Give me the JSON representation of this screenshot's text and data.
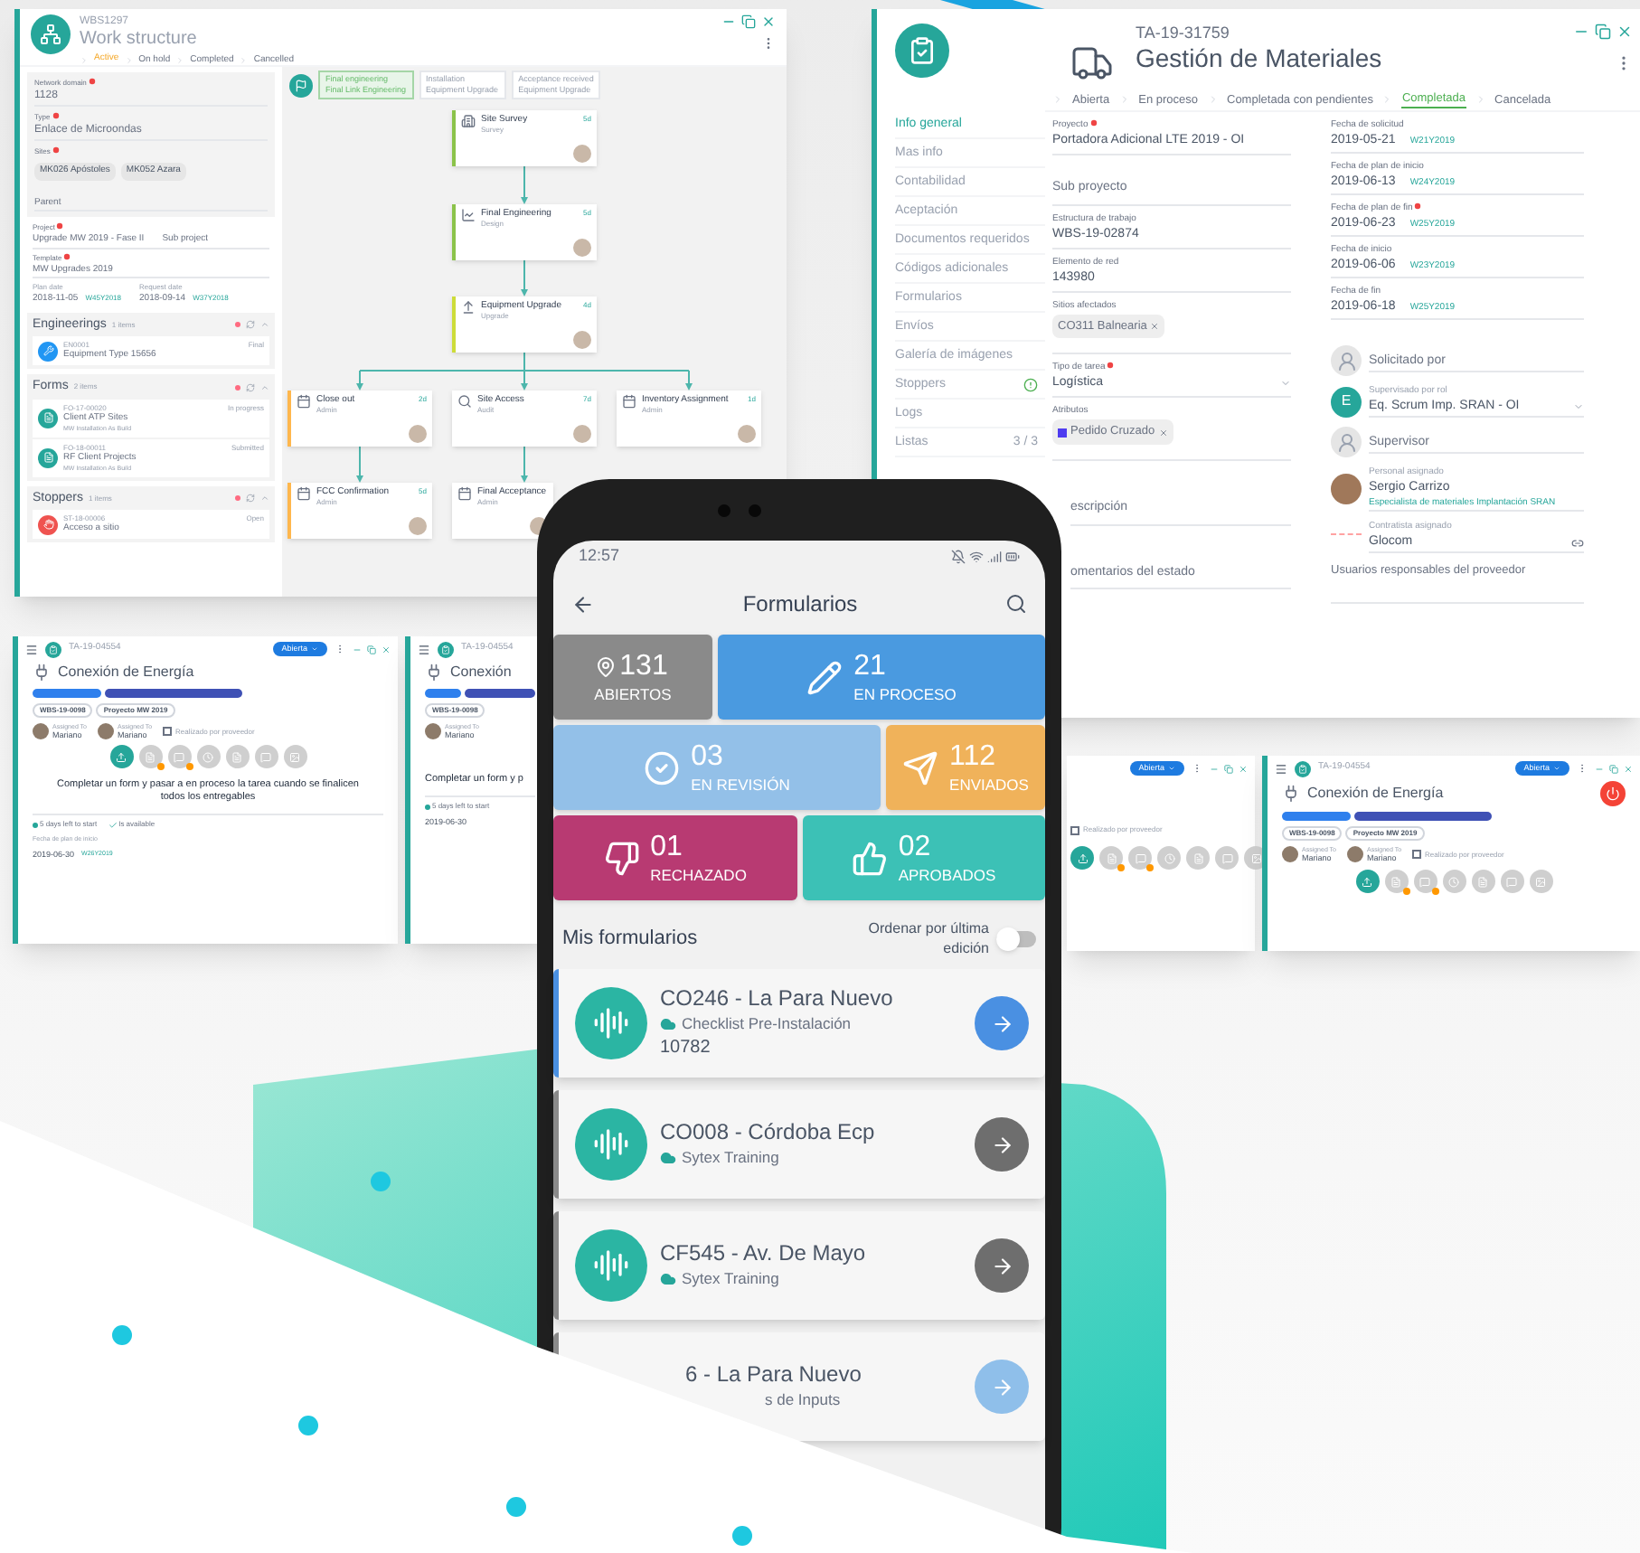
{
  "work_structure": {
    "code": "WBS1297",
    "title": "Work structure",
    "statuses": [
      {
        "label": "Active",
        "selected": true
      },
      {
        "label": "On hold",
        "selected": false
      },
      {
        "label": "Completed",
        "selected": false
      },
      {
        "label": "Cancelled",
        "selected": false
      }
    ],
    "fields": [
      {
        "label": "Network domain",
        "value": "1128",
        "required": true
      },
      {
        "label": "Type",
        "value": "Enlace de Microondas",
        "required": true
      }
    ],
    "sites": {
      "label": "Sites",
      "required": true,
      "chips": [
        "MK026 Apóstoles",
        "MK052 Azara"
      ]
    },
    "parent_placeholder": "Parent",
    "project": {
      "label": "Project",
      "required": true,
      "value": "Upgrade MW 2019 - Fase II",
      "sub_placeholder": "Sub project"
    },
    "template": {
      "label": "Template",
      "required": true,
      "value": "MW Upgrades 2019"
    },
    "dates": [
      {
        "label": "Plan date",
        "value": "2018-11-05",
        "week": "W45Y2018"
      },
      {
        "label": "Request date",
        "value": "2018-09-14",
        "week": "W37Y2018"
      }
    ],
    "sections": [
      {
        "title": "Engineerings",
        "count": "1 items",
        "kind": "engineering",
        "items": [
          {
            "code": "EN0001",
            "name": "Equipment Type 15656",
            "status": "Final"
          }
        ]
      },
      {
        "title": "Forms",
        "count": "2 items",
        "kind": "form",
        "items": [
          {
            "code": "FO-17-00020",
            "name": "Client ATP Sites",
            "sub": "MW Installation As Build",
            "status": "In progress"
          },
          {
            "code": "FO-18-00011",
            "name": "RF Client Projects",
            "sub": "MW Installation As Build",
            "status": "Submitted"
          }
        ]
      },
      {
        "title": "Stoppers",
        "count": "1 items",
        "kind": "stopper",
        "items": [
          {
            "code": "ST-18-00006",
            "name": "Acceso a sitio",
            "status": "Open"
          }
        ]
      }
    ],
    "stages": [
      {
        "title": "Final engineering",
        "subtitle": "Final Link Engineering",
        "selected": true
      },
      {
        "title": "Installation",
        "subtitle": "Equipment Upgrade",
        "selected": false
      },
      {
        "title": "Acceptance received",
        "subtitle": "Equipment Upgrade",
        "selected": false
      }
    ],
    "nodes": [
      {
        "title": "Site Survey",
        "type": "Survey",
        "duration": "5d",
        "color": "#8bc34a"
      },
      {
        "title": "Final Engineering",
        "type": "Design",
        "duration": "5d",
        "color": "#8bc34a"
      },
      {
        "title": "Equipment Upgrade",
        "type": "Upgrade",
        "duration": "4d",
        "color": "#cddc39"
      },
      {
        "title": "Close out",
        "type": "Admin",
        "duration": "2d",
        "color": "#ffb74d"
      },
      {
        "title": "Site Access",
        "type": "Audit",
        "duration": "7d"
      },
      {
        "title": "Inventory Assignment",
        "type": "Admin",
        "duration": "1d"
      },
      {
        "title": "FCC Confirmation",
        "type": "Admin",
        "duration": "5d",
        "color": "#ffb74d"
      },
      {
        "title": "Final Acceptance",
        "type": "Admin"
      }
    ]
  },
  "materials": {
    "code": "TA-19-31759",
    "title": "Gestión de Materiales",
    "statuses": [
      {
        "label": "Abierta",
        "selected": false
      },
      {
        "label": "En proceso",
        "selected": false
      },
      {
        "label": "Completada con pendientes",
        "selected": false
      },
      {
        "label": "Completada",
        "selected": true
      },
      {
        "label": "Cancelada",
        "selected": false
      }
    ],
    "menu": [
      {
        "label": "Info general",
        "selected": true,
        "alert": false
      },
      {
        "label": "Mas info",
        "selected": false,
        "alert": false
      },
      {
        "label": "Contabilidad",
        "selected": false,
        "alert": false
      },
      {
        "label": "Aceptación",
        "selected": false,
        "alert": false
      },
      {
        "label": "Documentos requeridos",
        "selected": false,
        "alert": false
      },
      {
        "label": "Códigos adicionales",
        "selected": false,
        "alert": false
      },
      {
        "label": "Formularios",
        "selected": false,
        "alert": false
      },
      {
        "label": "Envíos",
        "selected": false,
        "alert": false
      },
      {
        "label": "Galería de imágenes",
        "selected": false,
        "alert": false
      },
      {
        "label": "Stoppers",
        "selected": false,
        "alert": true
      },
      {
        "label": "Logs",
        "selected": false,
        "alert": false
      },
      {
        "label": "Listas",
        "count": "3 / 3",
        "selected": false,
        "alert": false
      }
    ],
    "left_fields": [
      {
        "kind": "text",
        "label": "Proyecto",
        "value": "Portadora Adicional LTE 2019 - OI",
        "required": true
      },
      {
        "kind": "placeholder",
        "placeholder": "Sub proyecto",
        "required": false
      },
      {
        "kind": "text",
        "label": "Estructura de trabajo",
        "value": "WBS-19-02874",
        "required": false
      },
      {
        "kind": "text",
        "label": "Elemento de red",
        "value": "143980",
        "required": false
      },
      {
        "kind": "chip",
        "label": "Sitios afectados",
        "value": "CO311 Balnearia",
        "required": false
      },
      {
        "kind": "select",
        "label": "Tipo de tarea",
        "value": "Logística",
        "required": true
      },
      {
        "kind": "chip",
        "label": "Atributos",
        "value": "Pedido Cruzado",
        "color": "#4f3cf0",
        "required": false
      },
      {
        "kind": "placeholder",
        "placeholder": "escripción",
        "required": false
      },
      {
        "kind": "placeholder",
        "placeholder": "omentarios del estado",
        "required": false
      }
    ],
    "dates": [
      {
        "label": "Fecha de solicitud",
        "value": "2019-05-21",
        "week": "W21Y2019",
        "required": false
      },
      {
        "label": "Fecha de plan de inicio",
        "value": "2019-06-13",
        "week": "W24Y2019",
        "required": false
      },
      {
        "label": "Fecha de plan de fin",
        "value": "2019-06-23",
        "week": "W25Y2019",
        "required": true
      },
      {
        "label": "Fecha de inicio",
        "value": "2019-06-06",
        "week": "W23Y2019",
        "required": false
      },
      {
        "label": "Fecha de fin",
        "value": "2019-06-18",
        "week": "W25Y2019",
        "required": false
      }
    ],
    "people": [
      {
        "kind": "empty",
        "placeholder": "Solicitado por"
      },
      {
        "kind": "initial",
        "initial": "E",
        "label": "Supervisado por rol",
        "value": "Eq. Scrum Imp. SRAN - OI"
      },
      {
        "kind": "empty",
        "placeholder": "Supervisor"
      },
      {
        "kind": "photo",
        "label": "Personal asignado",
        "value": "Sergio Carrizo",
        "link": "Especialista de materiales Implantación SRAN"
      },
      {
        "kind": "logo",
        "label": "Contratista asignado",
        "value": "Glocom"
      }
    ],
    "providers_placeholder": "Usuarios responsables del proveedor"
  },
  "task_windows": [
    {
      "kind": "full",
      "code": "TA-19-04554",
      "status": "Abierta",
      "title": "Conexión de Energía",
      "chips": [
        "WBS-19-0098",
        "Proyecto MW 2019"
      ],
      "assignees": [
        {
          "role": "Assigned To",
          "name": "Mariano"
        },
        {
          "role": "Assigned To",
          "name": "Mariano"
        }
      ],
      "check_label": "Realizado por proveedor",
      "checked": false,
      "description": "Completar un form y pasar a en proceso la tarea cuando se finalicen todos los entregables",
      "days_left": "5 days left to start",
      "available": "Is available",
      "date_label": "Fecha de plan de inicio",
      "date": "2019-06-30",
      "week": "W26Y2019"
    },
    {
      "kind": "clipped",
      "code": "TA-19-04554",
      "title": "Conexión",
      "chips": [
        "WBS-19-0098"
      ],
      "assignees": [
        {
          "role": "Assigned To",
          "name": "Mariano"
        }
      ],
      "description": "Completar un form y p",
      "days_left": "5 days left to start",
      "date": "2019-06-30"
    },
    {
      "kind": "tail",
      "status": "Abierta",
      "check_label": "Realizado por proveedor",
      "checked": false
    },
    {
      "kind": "full",
      "code": "TA-19-04554",
      "status": "Abierta",
      "title": "Conexión de Energía",
      "chips": [
        "WBS-19-0098",
        "Proyecto MW 2019"
      ],
      "assignees": [
        {
          "role": "Assigned To",
          "name": "Mariano"
        },
        {
          "role": "Assigned To",
          "name": "Mariano"
        }
      ],
      "check_label": "Realizado por proveedor",
      "checked": false
    }
  ],
  "phone": {
    "time": "12:57",
    "title": "Formularios",
    "tiles": [
      {
        "count": "131",
        "label": "ABIERTOS",
        "color": "#8a8a8a"
      },
      {
        "count": "21",
        "label": "EN PROCESO",
        "color": "#4a9ae0"
      },
      {
        "count": "03",
        "label": "EN REVISIÓN",
        "color": "#93c0e8"
      },
      {
        "count": "112",
        "label": "ENVIADOS",
        "color": "#f0b25a"
      },
      {
        "count": "01",
        "label": "RECHAZADO",
        "color": "#b83a72"
      },
      {
        "count": "02",
        "label": "APROBADOS",
        "color": "#3cc1b6"
      }
    ],
    "list_title": "Mis formularios",
    "sort_label": "Ordenar por última edición",
    "sort_on": false,
    "forms": [
      {
        "kind": "full",
        "title": "CO246 - La Para Nuevo",
        "sub": "Checklist Pre-Instalación",
        "extra": "10782",
        "selected": true,
        "color": "#4a90e2"
      },
      {
        "kind": "full",
        "title": "CO008 - Córdoba Ecp",
        "sub": "Sytex Training",
        "selected": false,
        "color": "#6e6e6e"
      },
      {
        "kind": "full",
        "title": "CF545 - Av. De Mayo",
        "sub": "Sytex Training",
        "selected": false,
        "color": "#6e6e6e"
      },
      {
        "kind": "partial",
        "title": "6 - La Para Nuevo",
        "sub": "s de Inputs",
        "selected": false,
        "color": "#8fbfea"
      }
    ]
  }
}
